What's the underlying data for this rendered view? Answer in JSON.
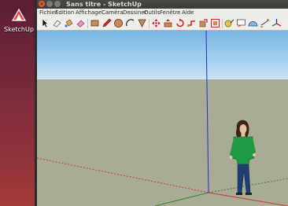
{
  "desktop": {
    "icon_label": "SketchUp"
  },
  "window": {
    "title": "Sans titre - SketchUp",
    "close_glyph": "×"
  },
  "menu": {
    "items": [
      "Fichier",
      "Édition",
      "Affichage",
      "Caméra",
      "Dessiner",
      "Outils",
      "Fenêtre",
      "Aide"
    ]
  },
  "toolbar": {
    "tools": [
      "select-icon",
      "eraser-icon",
      "paint-bucket-icon",
      "eraser-pink-icon",
      "rectangle-icon",
      "pencil-icon",
      "circle-icon",
      "arc-icon",
      "polygon-icon",
      "move-icon",
      "push-pull-icon",
      "rotate-icon",
      "follow-me-icon",
      "scale-icon",
      "offset-icon",
      "tape-measure-icon",
      "text-icon",
      "protractor-icon",
      "dimension-icon",
      "axes-icon"
    ]
  },
  "colors": {
    "sky_top": "#77b6e4",
    "ground": "#a9ab94",
    "axis_green": "#2c8a2c",
    "axis_blue": "#1f2fd0",
    "axis_red": "#c83a3a"
  }
}
